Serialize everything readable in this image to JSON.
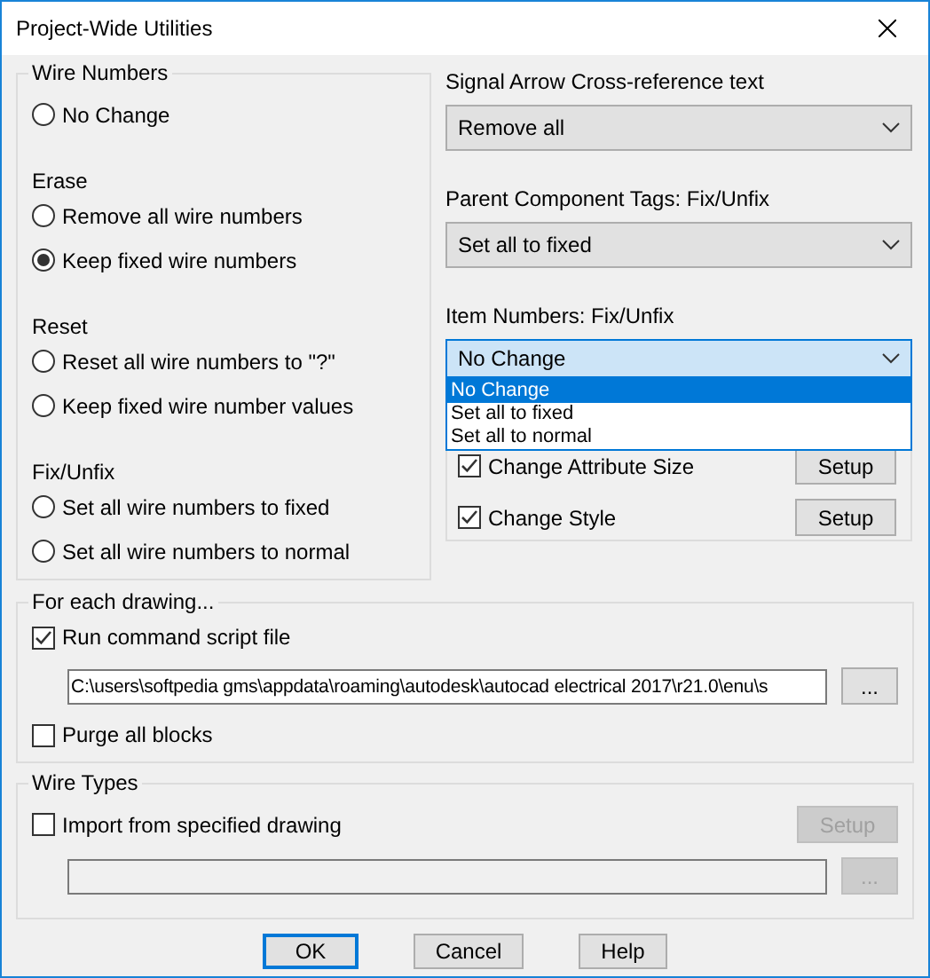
{
  "window": {
    "title": "Project-Wide Utilities"
  },
  "wire_numbers": {
    "title": "Wire Numbers",
    "options": [
      {
        "label": "No Change",
        "selected": false
      }
    ],
    "sections": [
      {
        "heading": "Erase",
        "options": [
          {
            "label": "Remove all wire numbers",
            "selected": false
          },
          {
            "label": "Keep fixed wire numbers",
            "selected": true
          }
        ]
      },
      {
        "heading": "Reset",
        "options": [
          {
            "label": "Reset all wire numbers to \"?\"",
            "selected": false
          },
          {
            "label": "Keep fixed wire number values",
            "selected": false
          }
        ]
      },
      {
        "heading": "Fix/Unfix",
        "options": [
          {
            "label": "Set all wire numbers to fixed",
            "selected": false
          },
          {
            "label": "Set all wire numbers to normal",
            "selected": false
          }
        ]
      }
    ]
  },
  "dropdowns": [
    {
      "label": "Signal Arrow Cross-reference text",
      "value": "Remove all",
      "open": false
    },
    {
      "label": "Parent Component Tags: Fix/Unfix",
      "value": "Set all to fixed",
      "open": false
    },
    {
      "label": "Item Numbers: Fix/Unfix",
      "value": "No Change",
      "open": true,
      "options": [
        {
          "label": "No Change",
          "selected": true
        },
        {
          "label": "Set all to fixed",
          "selected": false
        },
        {
          "label": "Set all to normal",
          "selected": false
        }
      ]
    }
  ],
  "attribute_options": [
    {
      "label": "Change Attribute Size",
      "checked": true,
      "button": "Setup"
    },
    {
      "label": "Change Style",
      "checked": true,
      "button": "Setup"
    }
  ],
  "for_each_drawing": {
    "title": "For each drawing...",
    "run_script": {
      "label": "Run command script file",
      "checked": true
    },
    "script_path": "C:\\users\\softpedia gms\\appdata\\roaming\\autodesk\\autocad electrical 2017\\r21.0\\enu\\s",
    "browse": {
      "label": "...",
      "disabled": false
    },
    "purge": {
      "label": "Purge all blocks",
      "checked": false
    }
  },
  "wire_types": {
    "title": "Wire Types",
    "import": {
      "label": "Import from specified drawing",
      "checked": false
    },
    "setup": {
      "label": "Setup",
      "disabled": true
    },
    "browse": {
      "label": "...",
      "disabled": true
    }
  },
  "buttons": [
    {
      "label": "OK",
      "default": true
    },
    {
      "label": "Cancel",
      "default": false
    },
    {
      "label": "Help",
      "default": false
    }
  ]
}
